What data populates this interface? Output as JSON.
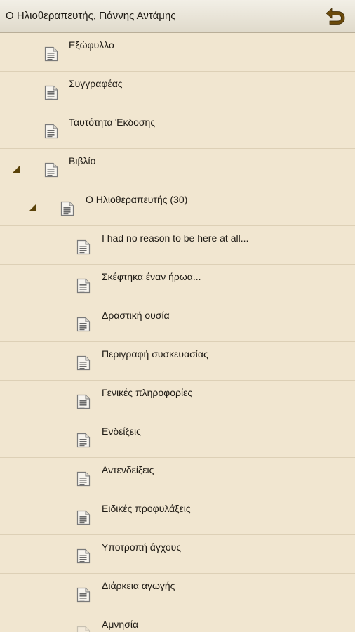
{
  "header": {
    "title": "Ο Ηλιοθεραπευτής, Γιάννης Αντάμης",
    "back_icon": "back-arrow-icon",
    "accent_color": "#6b4a0b"
  },
  "toc": [
    {
      "label": "Εξώφυλλο",
      "level": 0,
      "expanded": false
    },
    {
      "label": "Συγγραφέας",
      "level": 0,
      "expanded": false
    },
    {
      "label": "Ταυτότητα Έκδοσης",
      "level": 0,
      "expanded": false
    },
    {
      "label": "Βιβλίο",
      "level": 0,
      "expanded": true
    },
    {
      "label": "Ο Ηλιοθεραπευτής (30)",
      "level": 1,
      "expanded": true
    },
    {
      "label": "I had no reason to be here at all...",
      "level": 2,
      "expanded": false
    },
    {
      "label": "Σκέφτηκα έναν ήρωα...",
      "level": 2,
      "expanded": false
    },
    {
      "label": "Δραστική ουσία",
      "level": 2,
      "expanded": false
    },
    {
      "label": "Περιγραφή συσκευασίας",
      "level": 2,
      "expanded": false
    },
    {
      "label": "Γενικές πληροφορίες",
      "level": 2,
      "expanded": false
    },
    {
      "label": "Ενδείξεις",
      "level": 2,
      "expanded": false
    },
    {
      "label": "Αντενδείξεις",
      "level": 2,
      "expanded": false
    },
    {
      "label": "Ειδικές προφυλάξεις",
      "level": 2,
      "expanded": false
    },
    {
      "label": "Υποτροπή άγχους",
      "level": 2,
      "expanded": false
    },
    {
      "label": "Διάρκεια αγωγής",
      "level": 2,
      "expanded": false
    },
    {
      "label": "Αμνησία",
      "level": 2,
      "expanded": false
    }
  ]
}
